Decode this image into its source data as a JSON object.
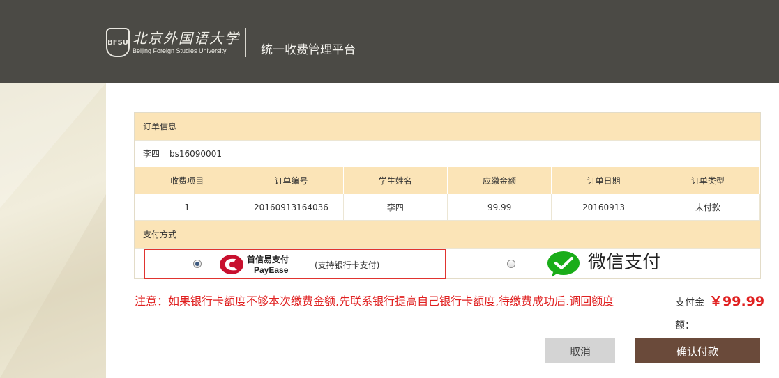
{
  "header": {
    "logo_seal_text": "BFSU",
    "logo_cn": "北京外国语大学",
    "logo_en": "Beijing Foreign Studies University",
    "platform_title": "统一收费管理平台"
  },
  "order_section": {
    "title": "订单信息",
    "student_name": "李四",
    "student_id": "bs16090001"
  },
  "orders_table": {
    "headers": [
      "收费项目",
      "订单编号",
      "学生姓名",
      "应缴金额",
      "订单日期",
      "订单类型"
    ],
    "rows": [
      [
        "1",
        "20160913164036",
        "李四",
        "99.99",
        "20160913",
        "未付款"
      ]
    ]
  },
  "payment_section": {
    "title": "支付方式",
    "payease_name_cn": "首信易支付",
    "payease_name_en": "PayEase",
    "payease_note": "(支持银行卡支付)",
    "payease_selected": true,
    "wechat_label": "微信支付",
    "wechat_selected": false
  },
  "notice": "注意：如果银行卡额度不够本次缴费金额,先联系银行提高自己银行卡额度,待缴费成功后.调回额度",
  "amount": {
    "label": "支付金",
    "label_cont": "额：",
    "value": "￥99.99"
  },
  "buttons": {
    "cancel": "取消",
    "confirm": "确认付款"
  },
  "colors": {
    "header_bg": "#4b4a45",
    "section_bg": "#fbe4b7",
    "notice_red": "#e02020",
    "confirm_bg": "#6a4a3a",
    "cancel_bg": "#d4d4d4",
    "highlight_border": "#e0342f"
  }
}
